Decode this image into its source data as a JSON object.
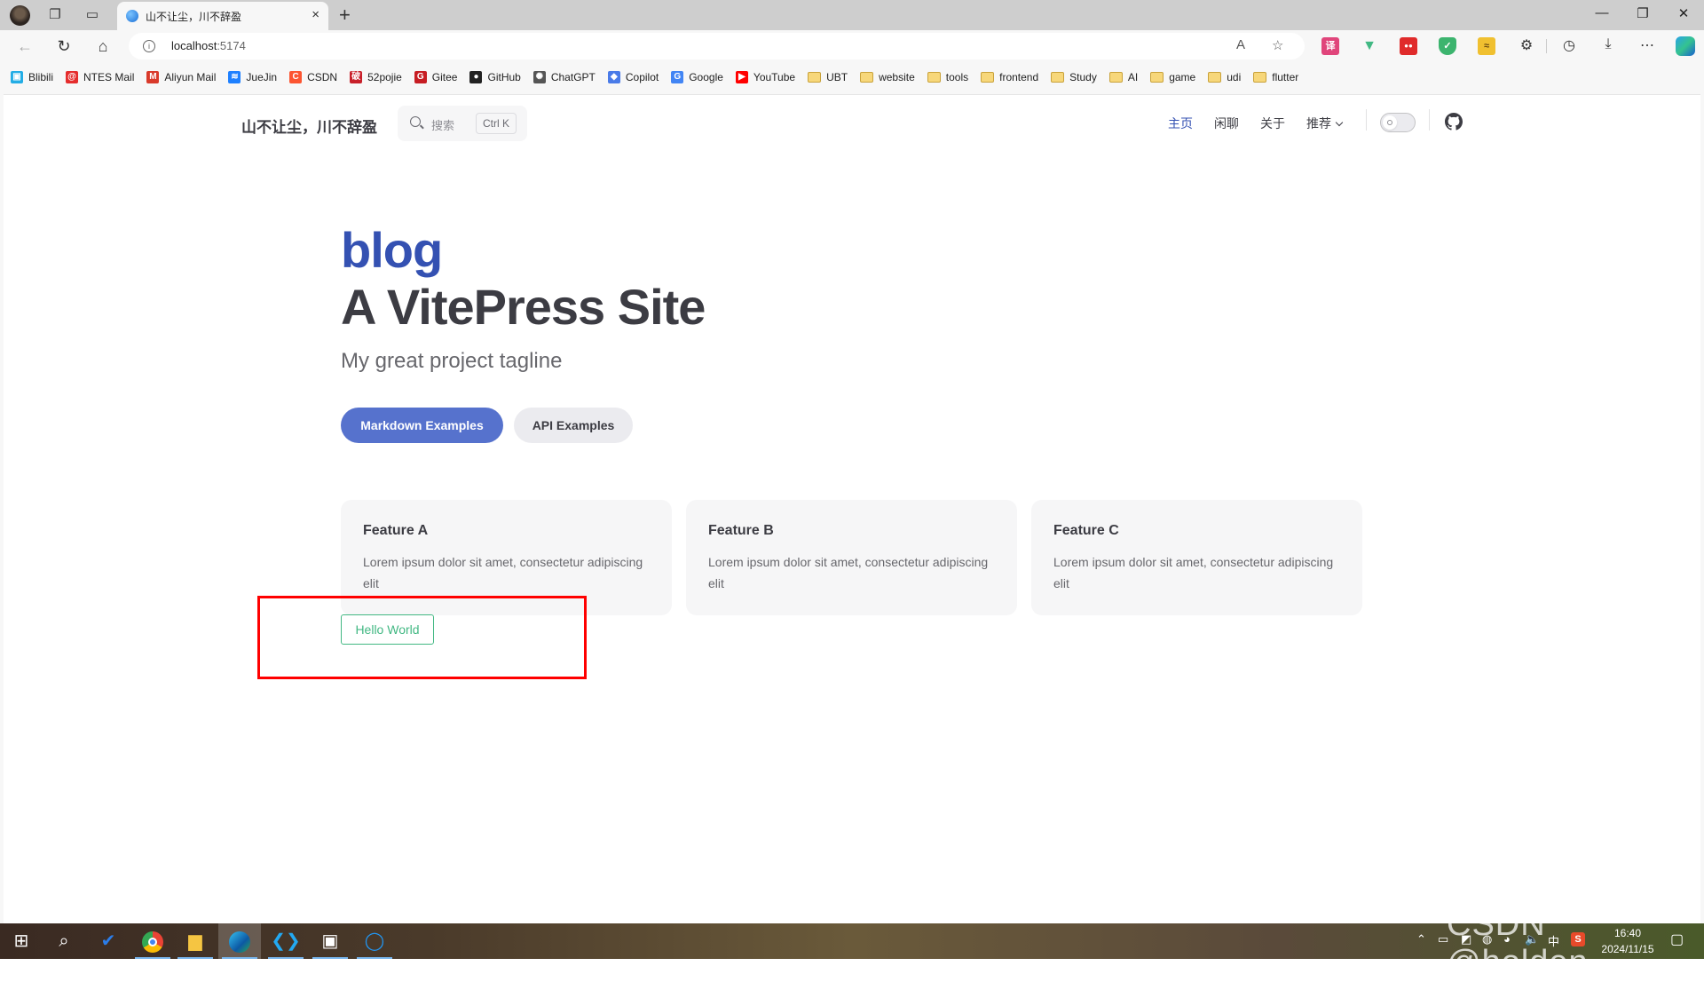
{
  "browser": {
    "tab": {
      "title": "山不让尘，川不辞盈",
      "close": "×"
    },
    "new_tab": "+",
    "window_controls": {
      "minimize": "—",
      "maximize": "❐",
      "close": "✕"
    },
    "address": {
      "host": "localhost",
      "port": ":5174"
    },
    "nav_icons": {
      "back": "←",
      "reload": "↻",
      "home": "⌂"
    },
    "toolbar_icons": {
      "read_aloud": "A",
      "favorite": "☆",
      "extensions": "⚙",
      "history": "◷",
      "downloads": "⤓",
      "more": "⋯"
    },
    "extensions": [
      {
        "name": "translate-extension-icon",
        "glyph": "译",
        "color": "#e0457b"
      },
      {
        "name": "vue-devtools-icon",
        "glyph": "V",
        "color": "#41b883"
      },
      {
        "name": "red-extension-icon",
        "glyph": "●●",
        "color": "#e02b2b"
      },
      {
        "name": "shield-extension-icon",
        "glyph": "✓",
        "color": "#3cb46e"
      },
      {
        "name": "tampermonkey-icon",
        "glyph": "🐈",
        "color": "#f0c030"
      }
    ],
    "bookmarks": [
      {
        "label": "Blibili",
        "icon": "bilibili",
        "color": "#23ade5",
        "glyph": "▣"
      },
      {
        "label": "NTES Mail",
        "icon": "ntes",
        "color": "#e52d2d",
        "glyph": "@"
      },
      {
        "label": "Aliyun Mail",
        "icon": "aliyun",
        "color": "#d93a2b",
        "glyph": "M"
      },
      {
        "label": "JueJin",
        "icon": "juejin",
        "color": "#1e80ff",
        "glyph": "≋"
      },
      {
        "label": "CSDN",
        "icon": "csdn",
        "color": "#fc5531",
        "glyph": "C"
      },
      {
        "label": "52pojie",
        "icon": "52pojie",
        "color": "#c8202a",
        "glyph": "破"
      },
      {
        "label": "Gitee",
        "icon": "gitee",
        "color": "#c71d23",
        "glyph": "G"
      },
      {
        "label": "GitHub",
        "icon": "github",
        "color": "#222222",
        "glyph": "●"
      },
      {
        "label": "ChatGPT",
        "icon": "chatgpt",
        "color": "#555555",
        "glyph": "✺"
      },
      {
        "label": "Copilot",
        "icon": "copilot",
        "color": "#4a7be8",
        "glyph": "◆"
      },
      {
        "label": "Google",
        "icon": "google",
        "color": "#4285f4",
        "glyph": "G"
      },
      {
        "label": "YouTube",
        "icon": "youtube",
        "color": "#ff0000",
        "glyph": "▶"
      },
      {
        "label": "UBT",
        "icon": "folder"
      },
      {
        "label": "website",
        "icon": "folder"
      },
      {
        "label": "tools",
        "icon": "folder"
      },
      {
        "label": "frontend",
        "icon": "folder"
      },
      {
        "label": "Study",
        "icon": "folder"
      },
      {
        "label": "AI",
        "icon": "folder"
      },
      {
        "label": "game",
        "icon": "folder"
      },
      {
        "label": "udi",
        "icon": "folder"
      },
      {
        "label": "flutter",
        "icon": "folder"
      }
    ]
  },
  "site": {
    "title": "山不让尘，川不辞盈",
    "search": {
      "placeholder": "搜索",
      "shortcut": "Ctrl K"
    },
    "nav": [
      {
        "label": "主页",
        "active": true
      },
      {
        "label": "闲聊",
        "active": false
      },
      {
        "label": "关于",
        "active": false
      },
      {
        "label": "推荐",
        "active": false,
        "dropdown": true
      }
    ],
    "appearance_toggle": "light",
    "hero": {
      "name": "blog",
      "text": "A VitePress Site",
      "tagline": "My great project tagline",
      "actions": [
        {
          "label": "Markdown Examples",
          "theme": "brand"
        },
        {
          "label": "API Examples",
          "theme": "alt"
        }
      ]
    },
    "features": [
      {
        "title": "Feature A",
        "details": "Lorem ipsum dolor sit amet, consectetur adipiscing elit"
      },
      {
        "title": "Feature B",
        "details": "Lorem ipsum dolor sit amet, consectetur adipiscing elit"
      },
      {
        "title": "Feature C",
        "details": "Lorem ipsum dolor sit amet, consectetur adipiscing elit"
      }
    ],
    "hello_button": "Hello World",
    "colors": {
      "brand": "#3451b2",
      "brand_button": "#5672cd",
      "hello_green": "#42b883",
      "annotation_red": "#ff0000"
    }
  },
  "taskbar": {
    "apps": [
      "start",
      "search",
      "todo",
      "chrome",
      "file-explorer",
      "edge",
      "vscode",
      "app-character",
      "chat-app"
    ],
    "tray": {
      "ime": "中",
      "time": "16:40",
      "date": "2024/11/15"
    },
    "watermark": "CSDN @holden_"
  }
}
